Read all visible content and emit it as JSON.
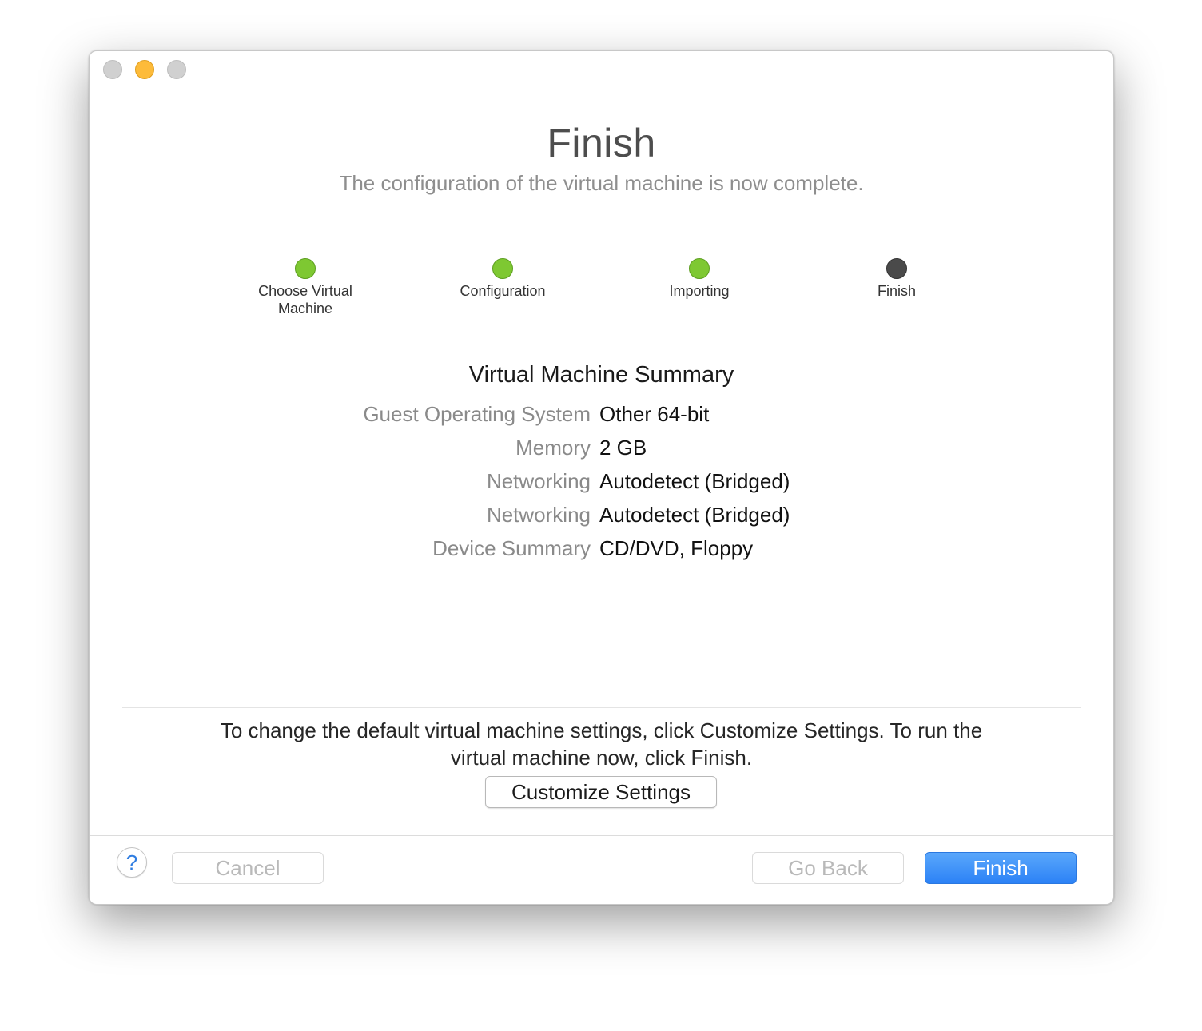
{
  "header": {
    "title": "Finish",
    "subtitle": "The configuration of the virtual machine is now complete."
  },
  "steps": [
    {
      "label_line1": "Choose Virtual",
      "label_line2": "Machine",
      "status": "done"
    },
    {
      "label_line1": "Configuration",
      "label_line2": "",
      "status": "done"
    },
    {
      "label_line1": "Importing",
      "label_line2": "",
      "status": "done"
    },
    {
      "label_line1": "Finish",
      "label_line2": "",
      "status": "current"
    }
  ],
  "summary": {
    "title": "Virtual Machine Summary",
    "rows": [
      {
        "label": "Guest Operating System",
        "value": "Other 64-bit"
      },
      {
        "label": "Memory",
        "value": "2 GB"
      },
      {
        "label": "Networking",
        "value": "Autodetect (Bridged)"
      },
      {
        "label": "Networking",
        "value": "Autodetect (Bridged)"
      },
      {
        "label": "Device Summary",
        "value": "CD/DVD, Floppy"
      }
    ]
  },
  "hint": {
    "line1": "To change the default virtual machine settings, click Customize Settings. To run the",
    "line2": "virtual machine now, click Finish."
  },
  "buttons": {
    "customize": "Customize Settings",
    "help": "?",
    "cancel": "Cancel",
    "go_back": "Go Back",
    "finish": "Finish"
  },
  "colors": {
    "step_done": "#7ec832",
    "step_current": "#4a4a4a",
    "primary_button": "#2c82f6",
    "minimize_light": "#fdbb3a"
  },
  "icons": {
    "help": "question-mark-icon"
  }
}
